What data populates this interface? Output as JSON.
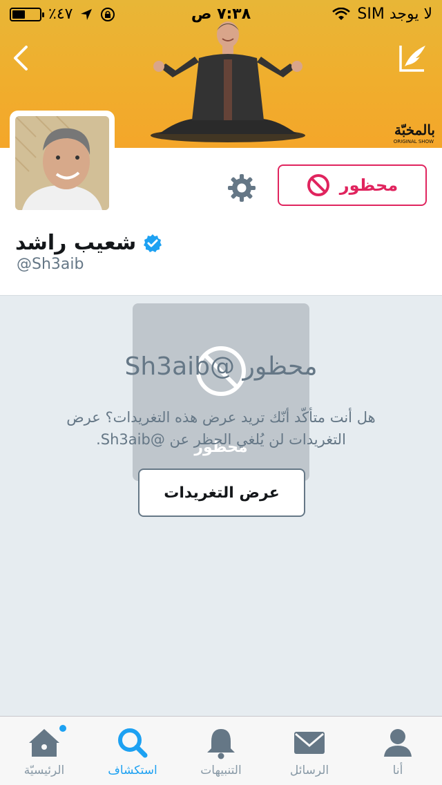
{
  "status_bar": {
    "carrier": "لا يوجد SIM",
    "time": "٧:٣٨ ص",
    "battery_text": "٪٤٧",
    "battery_level": 0.47
  },
  "banner": {
    "logo_text": "بالمخبّة",
    "logo_subtext": "ORIGINAL SHOW"
  },
  "profile": {
    "name": "شعيب راشد",
    "handle": "@Sh3aib",
    "verified": true,
    "blocked_button_label": "محظور"
  },
  "blocked": {
    "title": "محظور @Sh3aib",
    "message": "هل أنت متأكّد أنّك تريد عرض هذه التغريدات؟ عرض التغريدات لن يُلغي الحظر عن @Sh3aib.",
    "ghost_label": "محظور",
    "view_button_label": "عرض التغريدات"
  },
  "tabs": [
    {
      "label": "الرئيسيّة",
      "icon": "home-icon",
      "active": false,
      "has_dot": true
    },
    {
      "label": "استكشاف",
      "icon": "search-icon",
      "active": true,
      "has_dot": false
    },
    {
      "label": "التنبيهات",
      "icon": "bell-icon",
      "active": false,
      "has_dot": false
    },
    {
      "label": "الرسائل",
      "icon": "envelope-icon",
      "active": false,
      "has_dot": false
    },
    {
      "label": "أنا",
      "icon": "person-icon",
      "active": false,
      "has_dot": false
    }
  ],
  "colors": {
    "accent": "#1da1f2",
    "blocked_red": "#e0245e",
    "banner_yellow": "#f0ae2d",
    "muted_text": "#657786",
    "background": "#e6ecf0"
  }
}
